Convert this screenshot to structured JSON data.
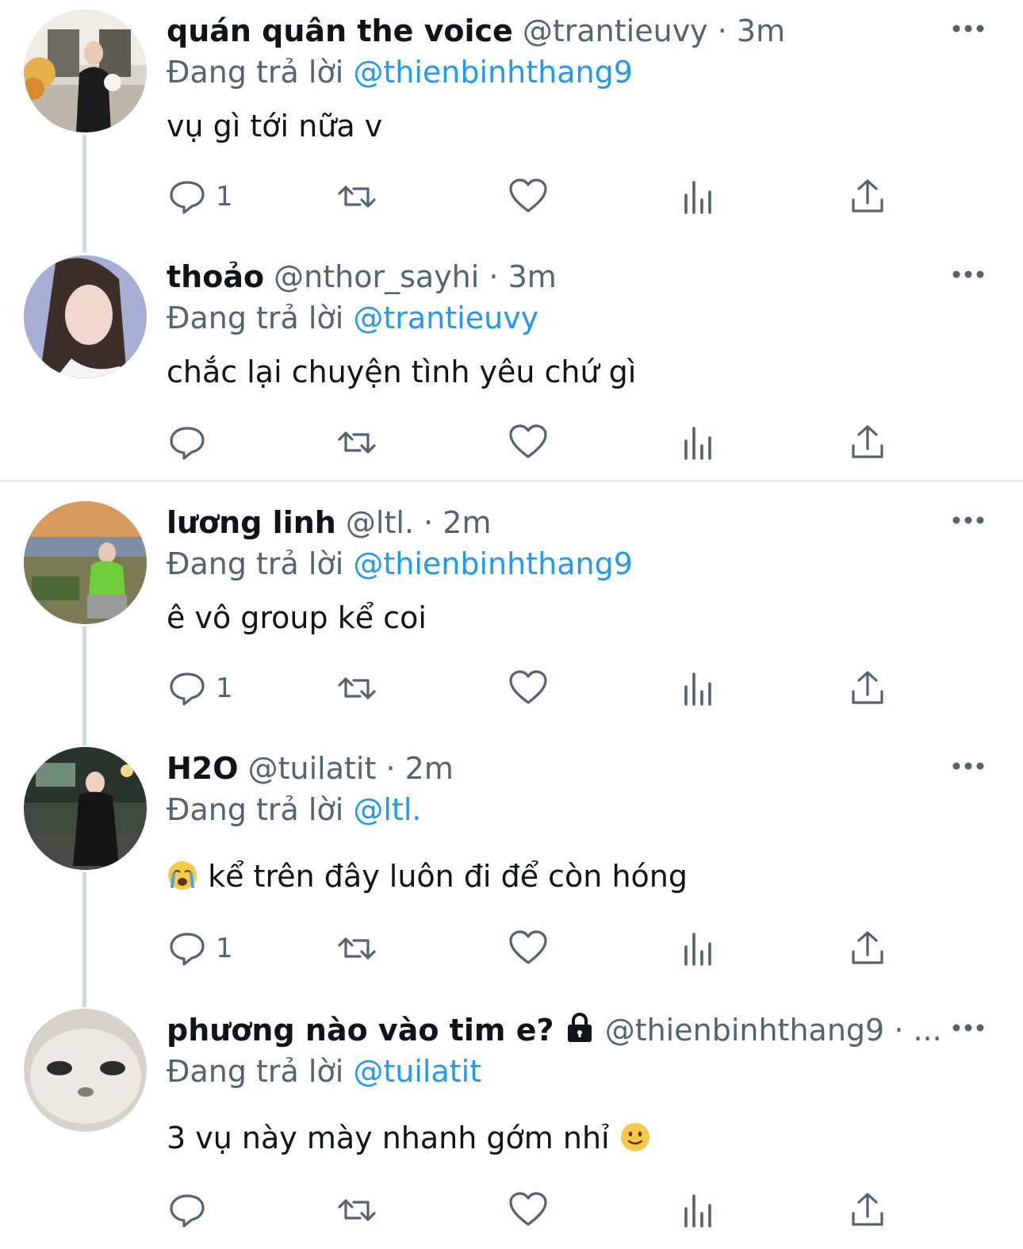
{
  "reply_prefix": "Đang trả lời",
  "tweets": [
    {
      "name": "quán quân the voice",
      "handle": "@trantieuvy",
      "time": "· 3m",
      "reply_to": "@thienbinhthang9",
      "text": "vụ gì tới nữa v",
      "reply_count": "1"
    },
    {
      "name": "thoảo",
      "handle": "@nthor_sayhi",
      "time": "· 3m",
      "reply_to": "@trantieuvy",
      "text": "chắc lại chuyện tình yêu chứ gì",
      "reply_count": ""
    },
    {
      "name": "lương linh",
      "handle": "@ltl.",
      "time": "· 2m",
      "reply_to": "@thienbinhthang9",
      "text": "ê vô group kể coi",
      "reply_count": "1"
    },
    {
      "name": "H2O",
      "handle": "@tuilatit",
      "time": "· 2m",
      "reply_to": "@ltl.",
      "text": "kể trên đây luôn đi để còn hóng",
      "reply_count": "1"
    },
    {
      "name": "phương nào vào tim e?",
      "handle": "@thienbinhthang9",
      "time": "· ...",
      "reply_to": "@tuilatit",
      "text": "3 vụ này mày nhanh gớm nhỉ",
      "reply_count": ""
    }
  ],
  "icons": {
    "reply": "reply-icon",
    "retweet": "retweet-icon",
    "like": "heart-icon",
    "views": "analytics-icon",
    "share": "share-icon",
    "more": "more-icon"
  },
  "colors": {
    "mention": "#1d9bf0",
    "meta": "#536471",
    "icon": "#536471"
  }
}
